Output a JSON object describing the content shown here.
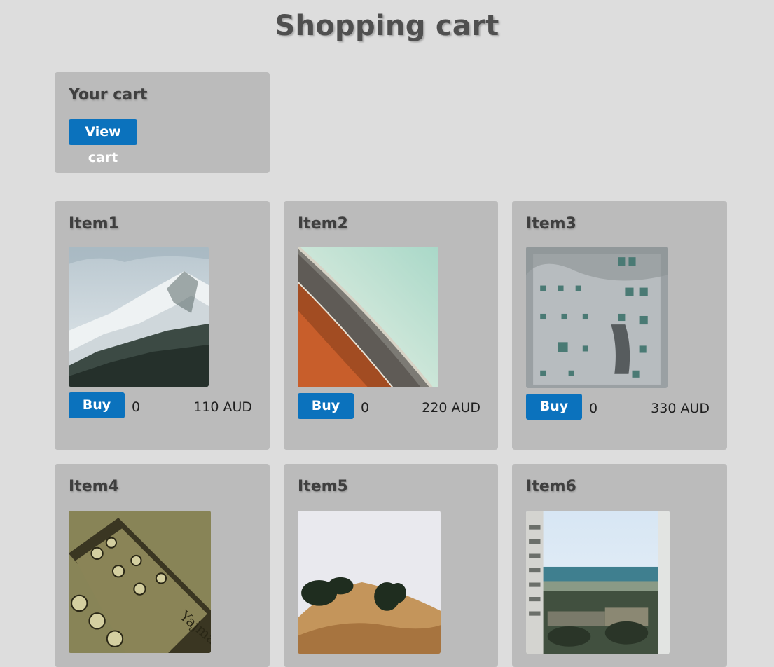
{
  "page": {
    "title": "Shopping cart"
  },
  "cart": {
    "heading": "Your cart",
    "view_label": "View cart"
  },
  "buy_label": "Buy",
  "items": [
    {
      "name": "Item1",
      "qty": "0",
      "price": "110 AUD",
      "image": "snowy-mountain"
    },
    {
      "name": "Item2",
      "qty": "0",
      "price": "220 AUD",
      "image": "curved-building-roof"
    },
    {
      "name": "Item3",
      "qty": "0",
      "price": "330 AUD",
      "image": "weathered-apartment-wall"
    },
    {
      "name": "Item4",
      "name_full": "Item4",
      "image": "guitar-headstock"
    },
    {
      "name": "Item5",
      "image": "foggy-hill-trees"
    },
    {
      "name": "Item6",
      "image": "sea-view-between-buildings"
    }
  ],
  "colors": {
    "button": "#0b72bd",
    "panel": "#bbbbbb",
    "background": "#dddddd"
  }
}
